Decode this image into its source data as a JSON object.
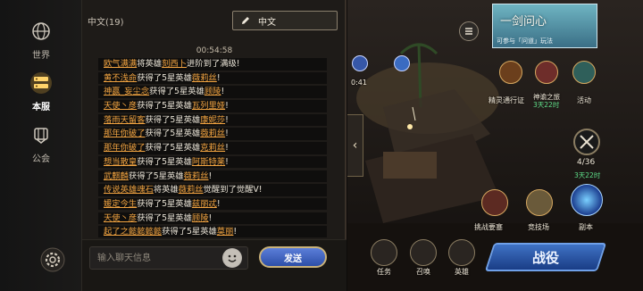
{
  "rail": {
    "items": [
      {
        "label": "世界"
      },
      {
        "label": "本服"
      },
      {
        "label": "公会"
      }
    ]
  },
  "chat": {
    "channel_count": "中文(19)",
    "language": "中文",
    "timestamp": "00:54:58",
    "messages": [
      {
        "name": "欧气满满",
        "pre": "将英雄",
        "hero": "刻西卜",
        "post": "进阶到了满级!"
      },
      {
        "name": "黄不浅命",
        "pre": "获得了5星英雄",
        "hero": "薇莉丝",
        "post": "!"
      },
      {
        "name": "神赢_妄尘念",
        "pre": "获得了5星英雄",
        "hero": "顾陵",
        "post": "!"
      },
      {
        "name": "天使丶彦",
        "pre": "获得了5星英雄",
        "hero": "瓦列里娅",
        "post": "!"
      },
      {
        "name": "落雨天留客",
        "pre": "获得了5星英雄",
        "hero": "康妮莎",
        "post": "!"
      },
      {
        "name": "那年你破了",
        "pre": "获得了5星英雄",
        "hero": "薇莉丝",
        "post": "!"
      },
      {
        "name": "那年你破了",
        "pre": "获得了5星英雄",
        "hero": "克莉丝",
        "post": "!"
      },
      {
        "name": "想当散皇",
        "pre": "获得了5星英雄",
        "hero": "阿斯特莱",
        "post": "!"
      },
      {
        "name": "武麒麟",
        "pre": "获得了5星英雄",
        "hero": "薇莉丝",
        "post": "!"
      },
      {
        "name": "传说英雄魂石",
        "pre": "将英雄",
        "hero": "薇莉丝",
        "post": "觉醒到了觉醒Ⅴ!"
      },
      {
        "name": "媛定今生",
        "pre": "获得了5星英雄",
        "hero": "兹丽忒",
        "post": "!"
      },
      {
        "name": "天使丶彦",
        "pre": "获得了5星英雄",
        "hero": "顾陵",
        "post": "!"
      },
      {
        "name": "起了之懿懿懿懿",
        "pre": "获得了5星英雄",
        "hero": "莫丽",
        "post": "!"
      }
    ],
    "input_placeholder": "输入聊天信息",
    "send_label": "发送"
  },
  "scene": {
    "banner_title": "一剑问心",
    "banner_sub": "可参与「问道」玩法",
    "timer_left": "0:41",
    "pass_label": "精灵通行证",
    "god_road_label": "神谕之旅",
    "god_road_sub": "3天22时",
    "activity_label": "活动",
    "counter": "4/36",
    "counter_sub": "3天22时",
    "challenge_label": "挑战要塞",
    "arena_label": "竞技场",
    "dungeon_label": "副本",
    "task_label": "任务",
    "summon_label": "召唤",
    "hero_label": "英雄",
    "battle_label": "战役"
  },
  "colors": {
    "player_name": "#f2a441",
    "send_button": "#2d4fa8",
    "highlight_green": "#5fe08a"
  }
}
